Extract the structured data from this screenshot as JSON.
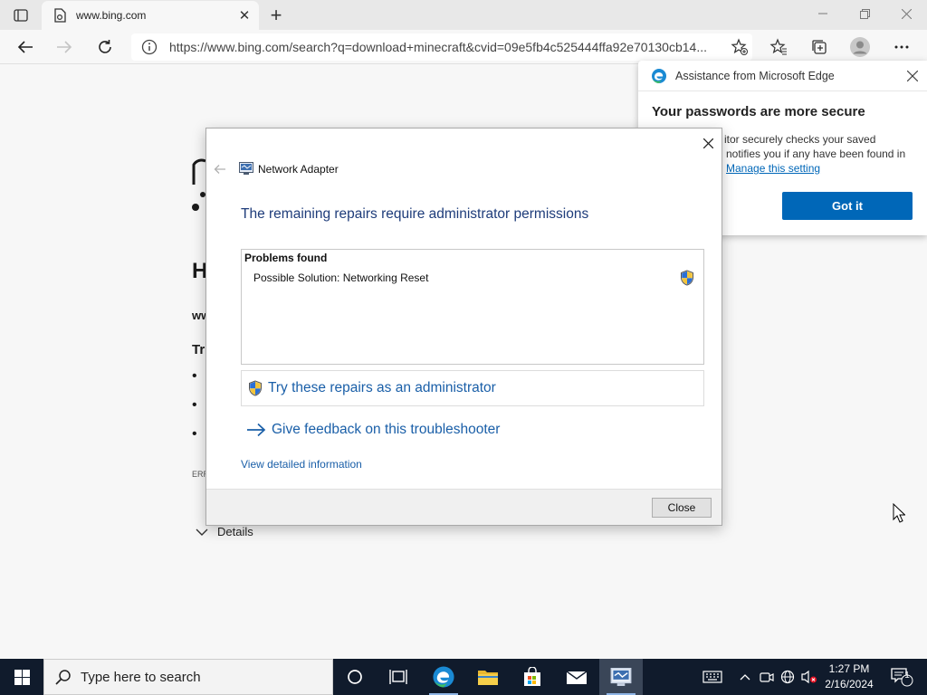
{
  "browser": {
    "tab_title": "www.bing.com",
    "new_tab_symbol": "+",
    "url": "https://www.bing.com/search?q=download+minecraft&cvid=09e5fb4c525444ffa92e70130cb14...",
    "window_controls": [
      "minimize",
      "restore",
      "close"
    ]
  },
  "background_page": {
    "visible_fragments": [
      "H",
      "ww",
      "Tr",
      "ERR"
    ],
    "details_label": "Details"
  },
  "assistance_popup": {
    "header_title": "Assistance from Microsoft Edge",
    "headline": "Your passwords are more secure",
    "body_line1": "itor securely checks your saved",
    "body_line2": "notifies you if any have been found in",
    "manage_link": "Manage this setting",
    "got_it_label": "Got it",
    "accent_color": "#0067b8"
  },
  "troubleshooter": {
    "title": "Network Adapter",
    "heading": "The remaining repairs require administrator permissions",
    "problems_title": "Problems found",
    "problem_item": "Possible Solution: Networking Reset",
    "try_repairs_label": "Try these repairs as an administrator",
    "feedback_label": "Give feedback on this troubleshooter",
    "view_details_label": "View detailed information",
    "close_button_label": "Close",
    "heading_color": "#1e3c7a",
    "link_color": "#1a5fa8"
  },
  "taskbar": {
    "search_placeholder": "Type here to search",
    "time": "1:27 PM",
    "date": "2/16/2024",
    "notification_count": "1",
    "apps": [
      "task-view",
      "edge",
      "file-explorer",
      "store",
      "mail",
      "troubleshooter"
    ]
  }
}
